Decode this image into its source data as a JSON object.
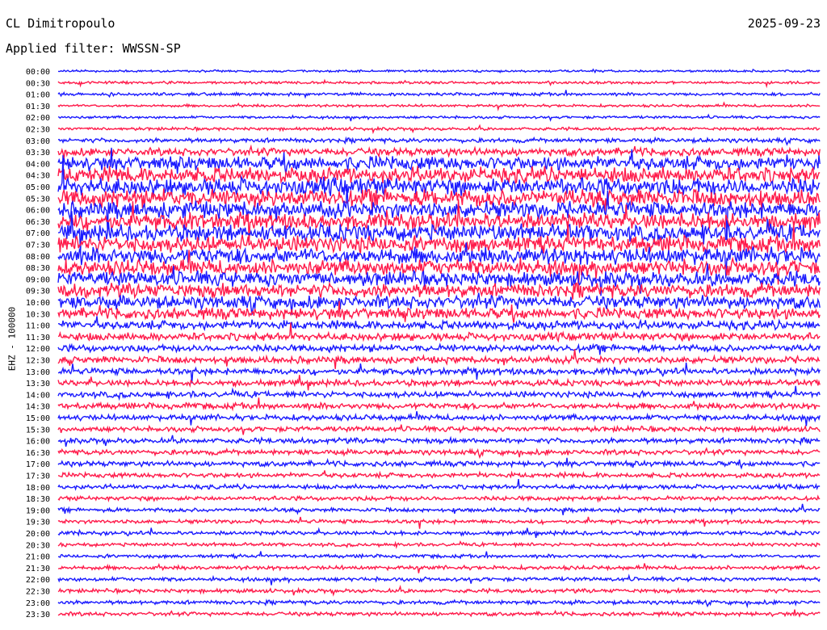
{
  "header": {
    "station": "CL Dimitropoulo",
    "date": "2025-09-23",
    "filter": "Applied filter: WWSSN-SP"
  },
  "chart_data": {
    "type": "line",
    "title": "CL Dimitropoulo",
    "ylabel": "EHZ - 100000",
    "row_labels": [
      "00:00",
      "00:30",
      "01:00",
      "01:30",
      "02:00",
      "02:30",
      "03:00",
      "03:30",
      "04:00",
      "04:30",
      "05:00",
      "05:30",
      "06:00",
      "06:30",
      "07:00",
      "07:30",
      "08:00",
      "08:30",
      "09:00",
      "09:30",
      "10:00",
      "10:30",
      "11:00",
      "11:30",
      "12:00",
      "12:30",
      "13:00",
      "13:30",
      "14:00",
      "14:30",
      "15:00",
      "15:30",
      "16:00",
      "16:30",
      "17:00",
      "17:30",
      "18:00",
      "18:30",
      "19:00",
      "19:30",
      "20:00",
      "20:30",
      "21:00",
      "21:30",
      "22:00",
      "22:30",
      "23:00",
      "23:30"
    ],
    "row_activity": [
      0.25,
      0.3,
      0.35,
      0.3,
      0.3,
      0.35,
      0.5,
      0.9,
      1.6,
      1.8,
      2.0,
      2.0,
      1.9,
      1.9,
      1.9,
      1.9,
      1.9,
      1.8,
      1.7,
      1.6,
      1.5,
      1.3,
      1.0,
      0.9,
      0.8,
      0.8,
      0.75,
      0.7,
      0.7,
      0.7,
      0.65,
      0.6,
      0.6,
      0.6,
      0.6,
      0.55,
      0.5,
      0.5,
      0.45,
      0.45,
      0.45,
      0.4,
      0.4,
      0.45,
      0.45,
      0.45,
      0.45,
      0.45
    ],
    "colors": {
      "even": "#1a1aff",
      "odd": "#ff1a4a"
    }
  }
}
